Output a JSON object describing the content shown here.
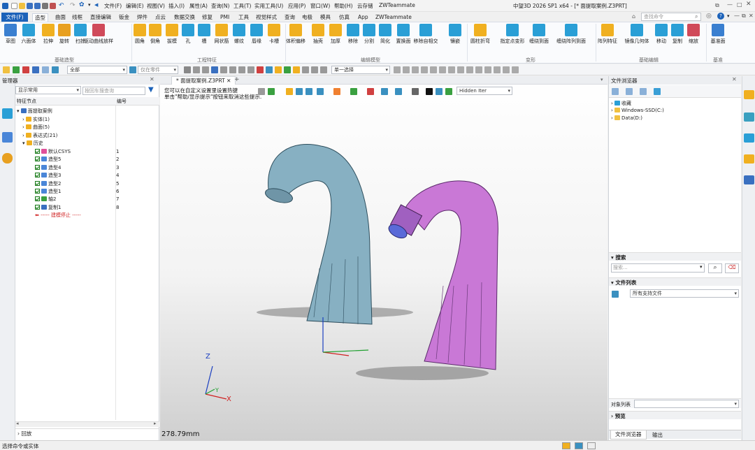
{
  "titlebar": {
    "title": "中望3D 2026 SP1 x64 - [* 面提取案例.Z3PRT]",
    "menus": [
      "文件(F)",
      "编辑(E)",
      "视图(V)",
      "插入(I)",
      "属性(A)",
      "查询(N)",
      "工具(T)",
      "实用工具(U)",
      "应用(P)",
      "窗口(W)",
      "帮助(H)",
      "云存储",
      "ZWTeammate"
    ],
    "search_placeholder": "查找命令"
  },
  "ribbon_tabs": {
    "file": "文件(F)",
    "tabs": [
      "造型",
      "曲面",
      "线框",
      "直接编辑",
      "钣金",
      "焊件",
      "点云",
      "数据交换",
      "修复",
      "PMI",
      "工具",
      "视觉样式",
      "查询",
      "电极",
      "模具",
      "仿真",
      "App",
      "ZWTeammate"
    ],
    "active": "造型"
  },
  "ribbon": {
    "buttons": [
      {
        "label": "草图",
        "color": "#3a7fd0"
      },
      {
        "label": "六面体",
        "color": "#2a9fd6"
      },
      {
        "label": "拉伸",
        "color": "#f0b020"
      },
      {
        "label": "旋转",
        "color": "#e8a020"
      },
      {
        "label": "扫掠",
        "color": "#2a9fd6"
      },
      {
        "label": "驱动曲线放样",
        "color": "#d04a5a"
      },
      {
        "label": "圆角",
        "color": "#f0b020"
      },
      {
        "label": "倒角",
        "color": "#f0b020"
      },
      {
        "label": "拔模",
        "color": "#f0b020"
      },
      {
        "label": "孔",
        "color": "#2a9fd6"
      },
      {
        "label": "槽",
        "color": "#2a9fd6"
      },
      {
        "label": "网状筋",
        "color": "#f0b020"
      },
      {
        "label": "螺纹",
        "color": "#2a9fd6"
      },
      {
        "label": "唇缘",
        "color": "#2a9fd6"
      },
      {
        "label": "卡槽",
        "color": "#f0b020"
      },
      {
        "label": "体积偏移",
        "color": "#f0b020"
      },
      {
        "label": "抽壳",
        "color": "#f0b020"
      },
      {
        "label": "加厚",
        "color": "#f0b020"
      },
      {
        "label": "移除",
        "color": "#2a9fd6"
      },
      {
        "label": "分割",
        "color": "#2a9fd6"
      },
      {
        "label": "简化",
        "color": "#2a9fd6"
      },
      {
        "label": "置换面",
        "color": "#2a9fd6"
      },
      {
        "label": "移除自相交",
        "color": "#2a9fd6"
      },
      {
        "label": "镶嵌",
        "color": "#2a9fd6"
      },
      {
        "label": "圆柱折弯",
        "color": "#f0b020"
      },
      {
        "label": "指定点变形",
        "color": "#2a9fd6"
      },
      {
        "label": "缠绕到面",
        "color": "#2a9fd6"
      },
      {
        "label": "缠绕阵列到面",
        "color": "#2a9fd6"
      },
      {
        "label": "阵列特征",
        "color": "#f0b020"
      },
      {
        "label": "镜像几何体",
        "color": "#2a9fd6"
      },
      {
        "label": "移动",
        "color": "#2a9fd6"
      },
      {
        "label": "复制",
        "color": "#2a9fd6"
      },
      {
        "label": "缩放",
        "color": "#d04a5a"
      },
      {
        "label": "基准面",
        "color": "#3a7fd0"
      }
    ],
    "groups": [
      "基础造型",
      "工程特征",
      "编辑模型",
      "变形",
      "基础编辑",
      "基准"
    ]
  },
  "toolbar2": {
    "filter_value": "全部",
    "part_filter": "仅在零件",
    "select_mode": "单一选择",
    "hidden_iter": "Hidden Iter"
  },
  "manager": {
    "title": "管理器",
    "filter": "显示常用",
    "search_placeholder": "按回车搜查询",
    "col_node": "特征节点",
    "col_num": "编号",
    "root": "面提取案例",
    "groups": [
      {
        "label": "实体(1)"
      },
      {
        "label": "曲面(5)"
      },
      {
        "label": "表达式(21)"
      },
      {
        "label": "历史"
      }
    ],
    "history": [
      {
        "label": "默认CSYS",
        "num": "1",
        "color": "#e0509a"
      },
      {
        "label": "造型5",
        "num": "2",
        "color": "#4a86d8"
      },
      {
        "label": "造型4",
        "num": "3",
        "color": "#4a86d8"
      },
      {
        "label": "造型3",
        "num": "4",
        "color": "#4a86d8"
      },
      {
        "label": "造型2",
        "num": "5",
        "color": "#4a86d8"
      },
      {
        "label": "造型1",
        "num": "6",
        "color": "#4a86d8"
      },
      {
        "label": "轴2",
        "num": "7",
        "color": "#3aa040"
      },
      {
        "label": "复制1",
        "num": "8",
        "color": "#3a6fc0"
      }
    ],
    "rollback": "----- 建模停止 -----",
    "footer": "回放"
  },
  "viewport": {
    "tab": "* 面提取案例.Z3PRT",
    "hint_line1": "您可以在自定义设置里设置热键",
    "hint_line2": "单击\"帮助/显示提示\"按钮来取消这些提示.",
    "dimension": "278.79mm",
    "axis_x": "X",
    "axis_y": "Y",
    "axis_z": "Z",
    "model1_color": "#87b0c2",
    "model2_color": "#c978d6"
  },
  "file_browser": {
    "title": "文件浏览器",
    "items": [
      "收藏",
      "Windows-SSD(C:)",
      "Data(D:)"
    ],
    "search_title": "搜索",
    "search_placeholder": "搜索...",
    "filelist_title": "文件列表",
    "filelist_filter": "所有支持文件",
    "object_list": "对象列表",
    "preview": "预览",
    "bottom_tabs": [
      "文件浏览器",
      "输出"
    ]
  },
  "status": {
    "text": "选择命令或实体"
  }
}
